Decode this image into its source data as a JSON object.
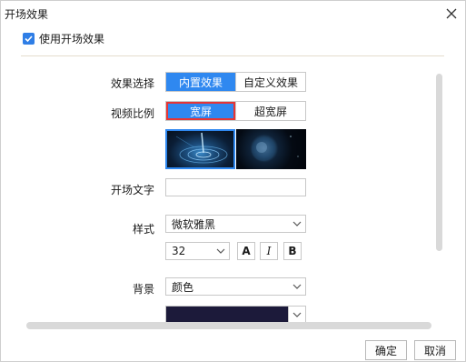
{
  "window": {
    "title": "开场效果"
  },
  "use_effect": {
    "label": "使用开场效果",
    "checked": true
  },
  "effect_select": {
    "label": "效果选择",
    "options": [
      "内置效果",
      "自定义效果"
    ],
    "selected": "内置效果"
  },
  "video_ratio": {
    "label": "视频比例",
    "options": [
      "宽屏",
      "超宽屏"
    ],
    "selected": "宽屏"
  },
  "thumbnails": {
    "items": [
      "swirl-thumbnail",
      "planet-thumbnail"
    ],
    "selected_index": 0
  },
  "opening_text": {
    "label": "开场文字",
    "value": ""
  },
  "style": {
    "label": "样式",
    "font_value": "微软雅黑",
    "size_value": "32",
    "bold_label": "A",
    "italic_label": "I",
    "b_label": "B"
  },
  "background": {
    "label": "背景",
    "type_value": "颜色",
    "color": "#1c1a3a"
  },
  "footer": {
    "ok_label": "确定",
    "cancel_label": "取消"
  },
  "colors": {
    "accent": "#2f88f0",
    "highlight_border": "#e63535",
    "checkbox": "#2f7ee6"
  }
}
